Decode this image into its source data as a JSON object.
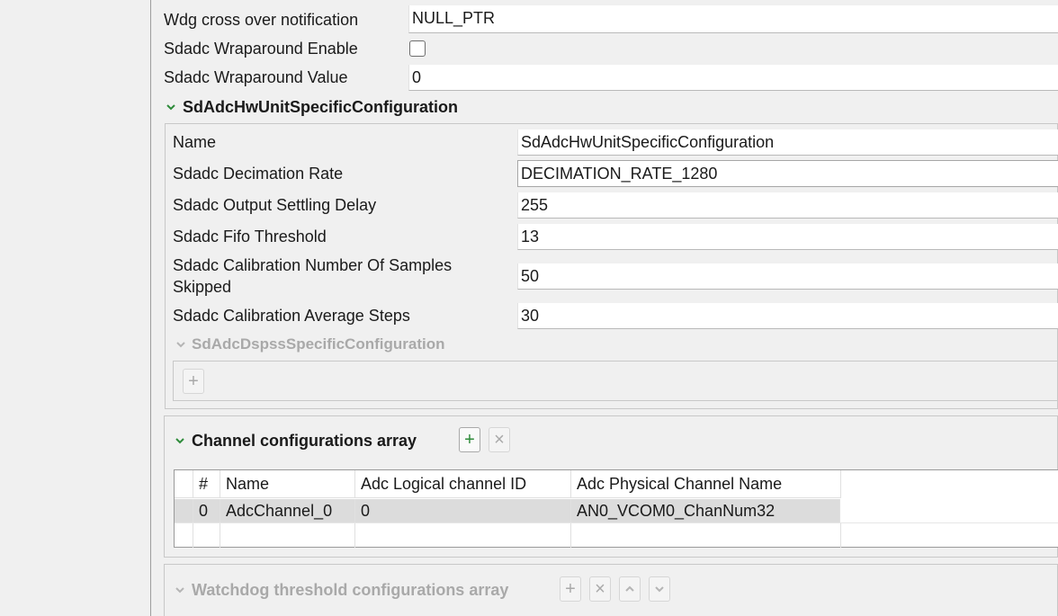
{
  "top_fields": {
    "wdg_label": "Wdg cross over notification",
    "wdg_value": "NULL_PTR",
    "wrap_enable_label": "Sdadc Wraparound Enable",
    "wrap_value_label": "Sdadc Wraparound Value",
    "wrap_value": "0"
  },
  "hw_unit": {
    "title": "SdAdcHwUnitSpecificConfiguration",
    "name_label": "Name",
    "name_value": "SdAdcHwUnitSpecificConfiguration",
    "decimation_label": "Sdadc Decimation Rate",
    "decimation_value": "DECIMATION_RATE_1280",
    "settling_label": "Sdadc Output Settling Delay",
    "settling_value": "255",
    "fifo_label": "Sdadc Fifo Threshold",
    "fifo_value": "13",
    "calib_skip_label_1": "Sdadc Calibration Number Of Samples",
    "calib_skip_label_2": "Skipped",
    "calib_skip_value": "50",
    "calib_avg_label": "Sdadc Calibration Average Steps",
    "calib_avg_value": "30",
    "dspss_title": "SdAdcDspssSpecificConfiguration",
    "dspss_add": "+"
  },
  "channels": {
    "title": "Channel configurations array",
    "add": "+",
    "remove": "×",
    "columns": [
      "#",
      "Name",
      "Adc Logical channel ID",
      "Adc Physical Channel Name"
    ],
    "rows": [
      [
        "0",
        "AdcChannel_0",
        "0",
        "AN0_VCOM0_ChanNum32"
      ]
    ]
  },
  "watchdog": {
    "title": "Watchdog threshold configurations array",
    "add": "+",
    "remove": "×"
  },
  "colors": {
    "accent_green": "#2e8b3a",
    "disabled_gray": "#a9a9a9"
  }
}
